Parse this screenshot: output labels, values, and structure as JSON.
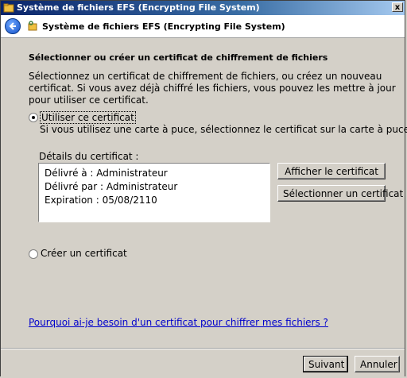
{
  "titlebar": {
    "title": "Système de fichiers EFS (Encrypting File System)",
    "close": "x"
  },
  "header": {
    "title": "Système de fichiers EFS (Encrypting File System)"
  },
  "main": {
    "section_title": "Sélectionner ou créer un certificat de chiffrement de fichiers",
    "description": "Sélectionnez un certificat de chiffrement de fichiers, ou créez un nouveau certificat. Si vous avez déjà chiffré les fichiers, vous pouvez les mettre à jour pour utiliser ce certificat.",
    "option_use": {
      "label": "Utiliser ce certificat",
      "checked": true
    },
    "option_use_hint": "Si vous utilisez une carte à puce, sélectionnez le certificat sur la carte à puce.",
    "details_label": "Détails du certificat :",
    "details": {
      "issued_to": "Délivré à : Administrateur",
      "issued_by": "Délivré par : Administrateur",
      "expiration": "Expiration : 05/08/2110"
    },
    "view_cert_button": "Afficher le certificat",
    "select_cert_button": "Sélectionner un certificat",
    "option_create": {
      "label": "Créer un certificat",
      "checked": false
    },
    "help_link": "Pourquoi ai-je besoin d'un certificat pour chiffrer mes fichiers ?"
  },
  "footer": {
    "next_button": "Suivant",
    "cancel_button": "Annuler"
  },
  "colors": {
    "titlebar": "#0a246a",
    "face": "#d4d0c8",
    "link": "#0000cc"
  }
}
